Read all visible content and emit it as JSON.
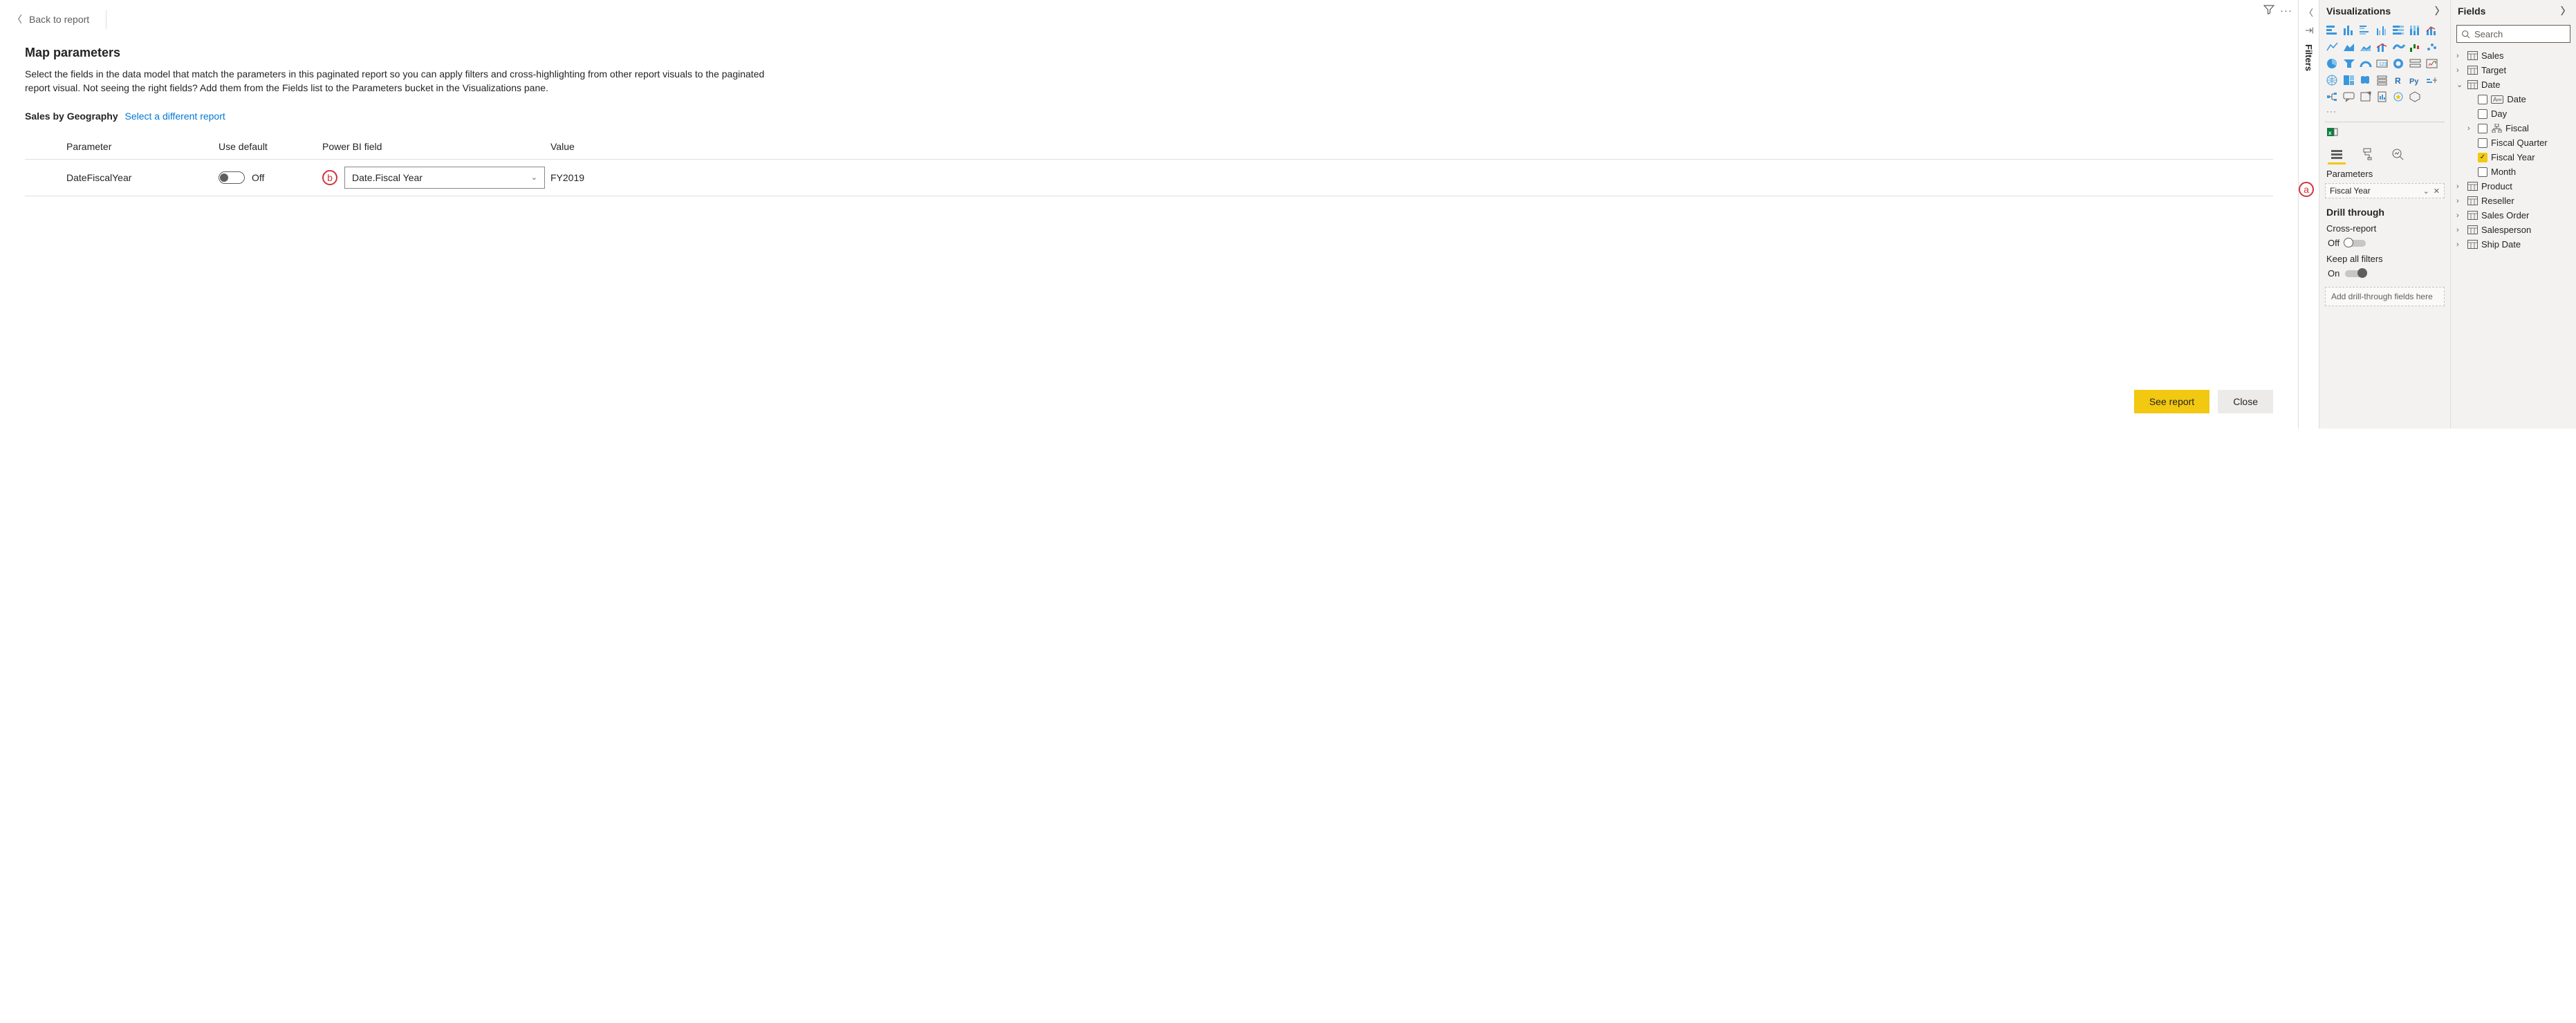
{
  "back_label": "Back to report",
  "title": "Map parameters",
  "description": "Select the fields in the data model that match the parameters in this paginated report so you can apply filters and cross-highlighting from other report visuals to the paginated report visual. Not seeing the right fields? Add them from the Fields list to the Parameters bucket in the Visualizations pane.",
  "report_name": "Sales by Geography",
  "select_different": "Select a different report",
  "table": {
    "headers": {
      "parameter": "Parameter",
      "use_default": "Use default",
      "field": "Power BI field",
      "value": "Value"
    },
    "row": {
      "parameter": "DateFiscalYear",
      "toggle_state": "Off",
      "field": "Date.Fiscal Year",
      "value": "FY2019"
    }
  },
  "annotations": {
    "a": "a",
    "b": "b"
  },
  "buttons": {
    "primary": "See report",
    "secondary": "Close"
  },
  "filters_tab": "Filters",
  "viz": {
    "title": "Visualizations",
    "more": "···",
    "parameters_label": "Parameters",
    "chip": "Fiscal Year",
    "drill_title": "Drill through",
    "cross_report": "Cross-report",
    "cross_state": "Off",
    "keep_filters": "Keep all filters",
    "keep_state": "On",
    "drop_hint": "Add drill-through fields here"
  },
  "fields": {
    "title": "Fields",
    "search_placeholder": "Search",
    "tables": [
      {
        "name": "Sales",
        "expanded": false
      },
      {
        "name": "Target",
        "expanded": false
      },
      {
        "name": "Date",
        "expanded": true,
        "children": [
          {
            "name": "Date",
            "checked": false,
            "type": "abc"
          },
          {
            "name": "Day",
            "checked": false
          },
          {
            "name": "Fiscal",
            "checked": false,
            "hier": true,
            "expandable": true
          },
          {
            "name": "Fiscal Quarter",
            "checked": false
          },
          {
            "name": "Fiscal Year",
            "checked": true
          },
          {
            "name": "Month",
            "checked": false
          }
        ]
      },
      {
        "name": "Product",
        "expanded": false
      },
      {
        "name": "Reseller",
        "expanded": false
      },
      {
        "name": "Sales Order",
        "expanded": false
      },
      {
        "name": "Salesperson",
        "expanded": false
      },
      {
        "name": "Ship Date",
        "expanded": false
      }
    ]
  }
}
